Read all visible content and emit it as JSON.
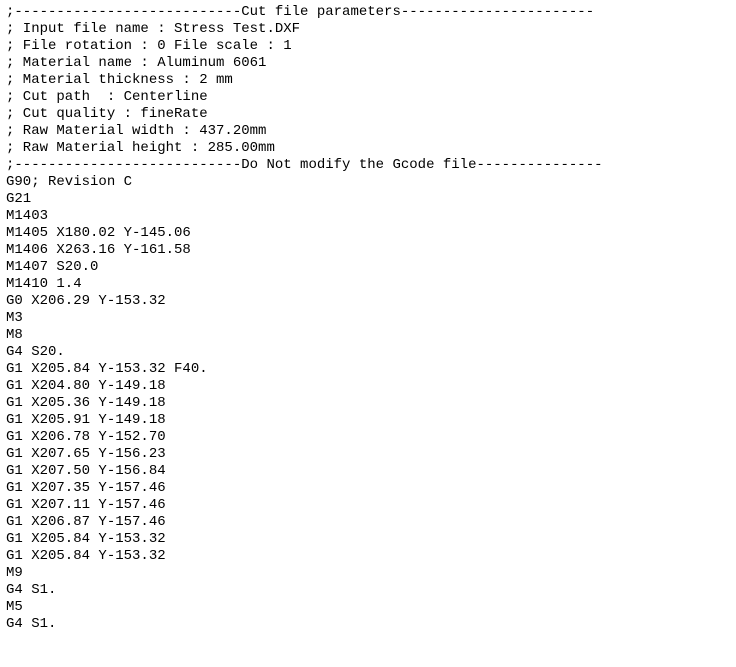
{
  "lines": [
    ";---------------------------Cut file parameters-----------------------",
    "; Input file name : Stress Test.DXF",
    "; File rotation : 0 File scale : 1",
    "; Material name : Aluminum 6061",
    "; Material thickness : 2 mm",
    "; Cut path  : Centerline",
    "; Cut quality : fineRate",
    "; Raw Material width : 437.20mm",
    "; Raw Material height : 285.00mm",
    ";---------------------------Do Not modify the Gcode file---------------",
    "G90; Revision C",
    "G21",
    "M1403",
    "M1405 X180.02 Y-145.06",
    "M1406 X263.16 Y-161.58",
    "M1407 S20.0",
    "M1410 1.4",
    "G0 X206.29 Y-153.32",
    "M3",
    "M8",
    "G4 S20.",
    "G1 X205.84 Y-153.32 F40.",
    "G1 X204.80 Y-149.18",
    "G1 X205.36 Y-149.18",
    "G1 X205.91 Y-149.18",
    "G1 X206.78 Y-152.70",
    "G1 X207.65 Y-156.23",
    "G1 X207.50 Y-156.84",
    "G1 X207.35 Y-157.46",
    "G1 X207.11 Y-157.46",
    "G1 X206.87 Y-157.46",
    "G1 X205.84 Y-153.32",
    "G1 X205.84 Y-153.32",
    "M9",
    "G4 S1.",
    "M5",
    "G4 S1."
  ]
}
